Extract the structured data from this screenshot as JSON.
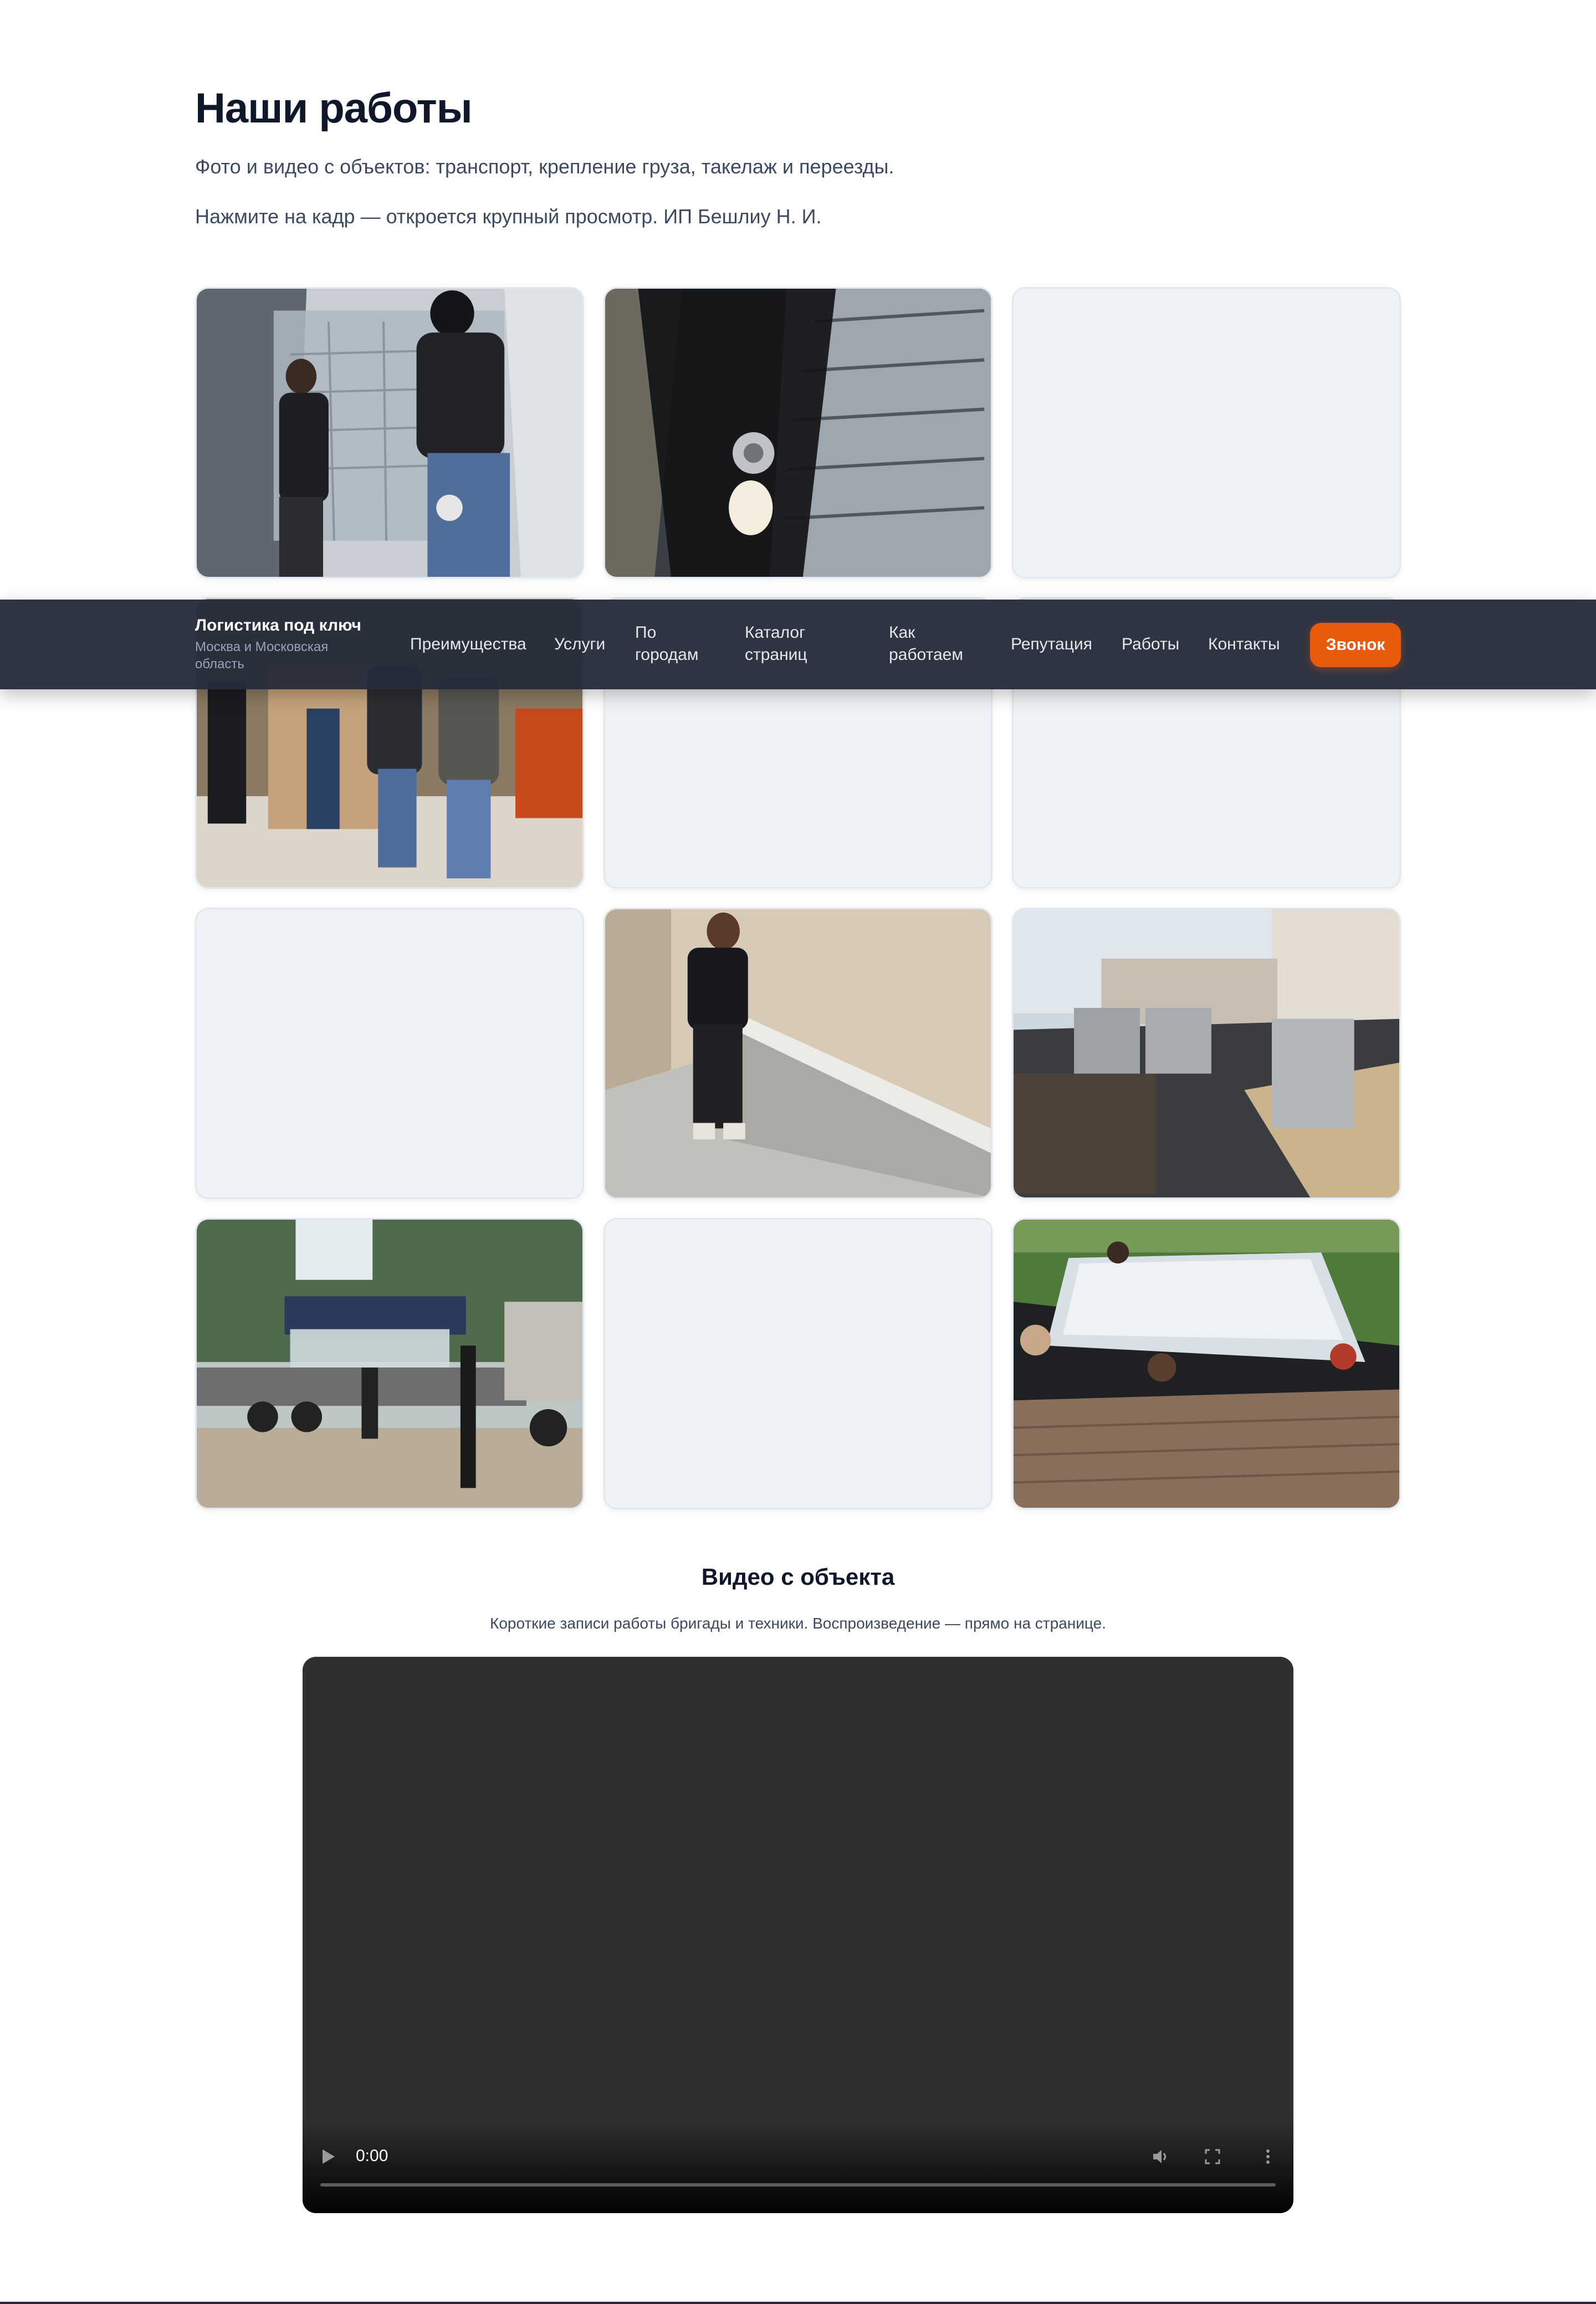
{
  "works": {
    "title": "Наши работы",
    "lead1": "Фото и видео с объектов: транспорт, крепление груза, такелаж и переезды.",
    "lead2": "Нажмите на кадр — откроется крупный просмотр. ИП Бешлиу Н. И."
  },
  "gallery": {
    "tiles": [
      {
        "kind": "photo-glass-installers"
      },
      {
        "kind": "photo-glass-closeup"
      },
      {
        "kind": "empty"
      },
      {
        "kind": "photo-office-movers"
      },
      {
        "kind": "empty"
      },
      {
        "kind": "empty"
      },
      {
        "kind": "empty"
      },
      {
        "kind": "photo-wall-panel"
      },
      {
        "kind": "photo-rooftop-units"
      },
      {
        "kind": "photo-crane-truck"
      },
      {
        "kind": "empty"
      },
      {
        "kind": "photo-pool-install"
      }
    ]
  },
  "nav": {
    "brand": "Логистика под ключ",
    "region": "Москва и Московская область",
    "items": [
      "Преимущества",
      "Услуги",
      "По городам",
      "Каталог страниц",
      "Как работаем",
      "Репутация",
      "Работы",
      "Контакты"
    ],
    "call": "Звонок"
  },
  "video": {
    "title": "Видео с объекта",
    "subtitle": "Короткие записи работы бригады и техники. Воспроизведение — прямо на странице.",
    "time": "0:00"
  },
  "colors": {
    "accent": "#e85a0c",
    "nav_bg": "#262c3a",
    "tile_empty": "#eff3f8",
    "video_bg": "#2f2f2f"
  }
}
